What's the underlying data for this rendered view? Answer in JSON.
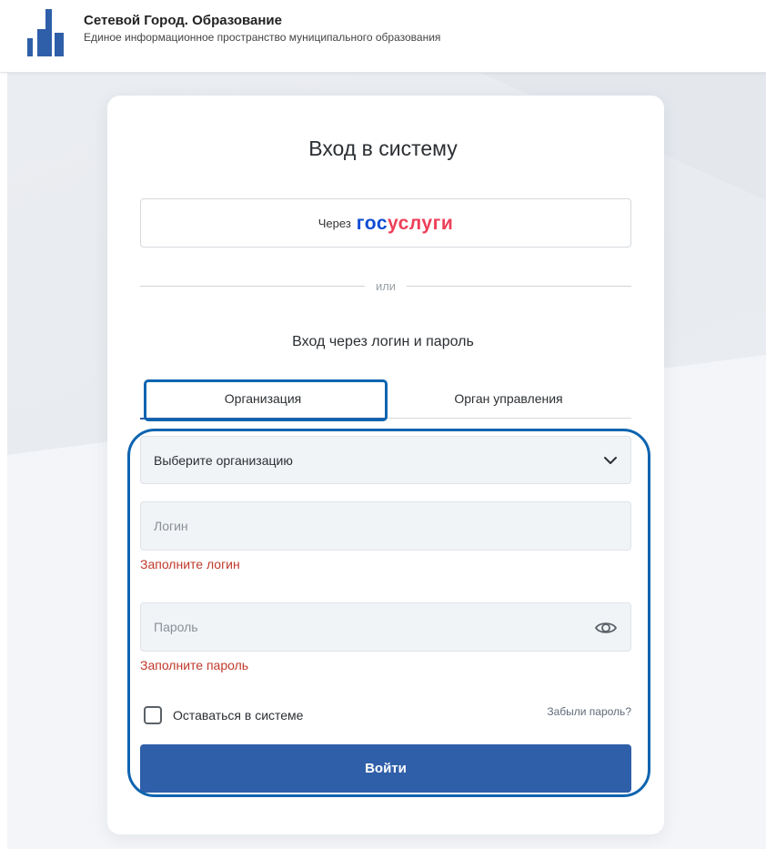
{
  "header": {
    "title": "Сетевой Город. Образование",
    "subtitle": "Единое информационное пространство муниципального образования",
    "logo_icon": "city-bars-logo-icon"
  },
  "login": {
    "title": "Вход в систему",
    "gosuslugi_prefix": "Через",
    "gosuslugi_logo_part1": "гос",
    "gosuslugi_logo_part2": "услуги",
    "divider_text": "или",
    "caption": "Вход через логин и пароль",
    "tabs": [
      {
        "label": "Организация",
        "active": true
      },
      {
        "label": "Орган управления",
        "active": false
      }
    ],
    "organization_select": {
      "selected": "Выберите организацию",
      "icon": "chevron-down-icon"
    },
    "login_field": {
      "value": "",
      "placeholder": "Логин",
      "error": "Заполните логин"
    },
    "password_field": {
      "value": "",
      "placeholder": "Пароль",
      "error": "Заполните пароль",
      "icon": "eye-icon"
    },
    "remember_label": "Оставаться в системе",
    "remember_checked": false,
    "forgot_label": "Забыли пароль?",
    "submit_label": "Войти"
  },
  "colors": {
    "accent": "#2f5fa9",
    "highlight_outline": "#0d64b0",
    "error": "#c0392b",
    "gosuslugi_blue": "#0d4cd3",
    "gosuslugi_red": "#ee3f58",
    "input_bg": "#f1f4f7"
  }
}
